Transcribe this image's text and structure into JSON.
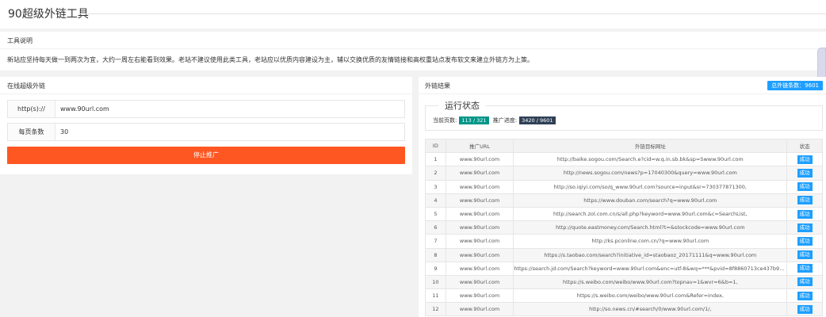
{
  "header": {
    "title": "90超级外链工具"
  },
  "intro": {
    "heading": "工具说明",
    "text": "新站应坚持每天做一到两次为宜，大约一周左右能看到效果。老站不建议使用此类工具，老站应以优质内容建设为主，辅以交换优质的友情链接和高权重站点发布软文来建立外链方为上策。"
  },
  "form": {
    "heading": "在线超级外链",
    "url_label": "http(s)://",
    "url_value": "www.90url.com",
    "per_page_label": "每页条数",
    "per_page_value": "30",
    "stop_label": "停止推广"
  },
  "results": {
    "heading": "外链结果",
    "total_badge": "总外链条数：9601",
    "status_legend": "运行状态",
    "pages_label": "当前页数:",
    "pages_value": "113 / 321",
    "progress_label": "推广进度:",
    "progress_value": "3420 / 9601",
    "columns": [
      "ID",
      "推广URL",
      "外链目标网址",
      "状态"
    ],
    "rows": [
      {
        "id": "1",
        "url": "www.90url.com",
        "target": "http://baike.sogou.com/Search.e?cid=w.q.in.sb.bk&sp=Swww.90url.com",
        "status": "成功"
      },
      {
        "id": "2",
        "url": "www.90url.com",
        "target": "http://news.sogou.com/news?p=17040300&query=www.90url.com",
        "status": "成功"
      },
      {
        "id": "3",
        "url": "www.90url.com",
        "target": "http://so.iqiyi.com/so/q_www.90url.com?source=input&sr=730377871300,",
        "status": "成功"
      },
      {
        "id": "4",
        "url": "www.90url.com",
        "target": "https://www.douban.com/search?q=www.90url.com",
        "status": "成功"
      },
      {
        "id": "5",
        "url": "www.90url.com",
        "target": "http://search.zol.com.cn/s/all.php?keyword=www.90url.com&c=SearchList,",
        "status": "成功"
      },
      {
        "id": "6",
        "url": "www.90url.com",
        "target": "http://quote.eastmoney.com/Search.html?t=&stockcode=www.90url.com",
        "status": "成功"
      },
      {
        "id": "7",
        "url": "www.90url.com",
        "target": "http://ks.pconline.com.cn/?q=www.90url.com",
        "status": "成功"
      },
      {
        "id": "8",
        "url": "www.90url.com",
        "target": "https://s.taobao.com/search?initiative_id=staobaoz_20171111&q=www.90url.com",
        "status": "成功"
      },
      {
        "id": "9",
        "url": "www.90url.com",
        "target": "https://search.jd.com/Search?keyword=www.90url.com&enc=utf-8&wq=***&pvid=8f8860713ce437b90c805...",
        "status": "成功"
      },
      {
        "id": "10",
        "url": "www.90url.com",
        "target": "https://s.weibo.com/weibo/www.90url.com?topnav=1&wvr=6&b=1,",
        "status": "成功"
      },
      {
        "id": "11",
        "url": "www.90url.com",
        "target": "https://s.weibo.com/weibo/www.90url.com&Refer=index,",
        "status": "成功"
      },
      {
        "id": "12",
        "url": "www.90url.com",
        "target": "http://so.news.cn/#search/0/www.90url.com/1/,",
        "status": "成功"
      }
    ]
  }
}
